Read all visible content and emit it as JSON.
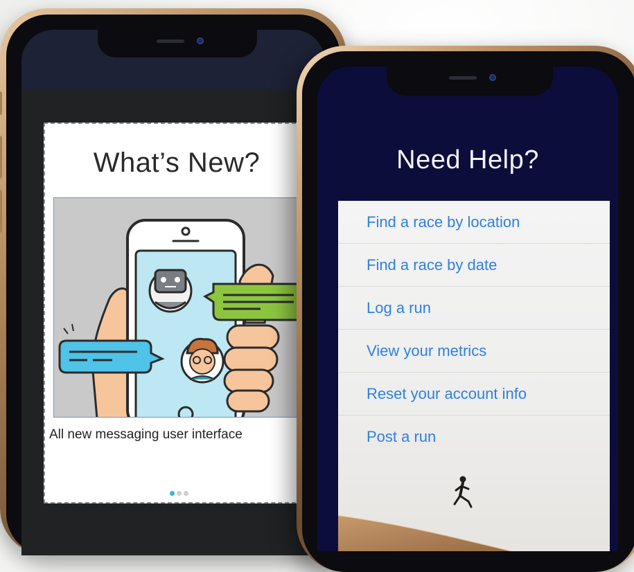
{
  "whats_new": {
    "title": "What’s New?",
    "caption": "All new messaging user interface",
    "pager": {
      "count": 3,
      "active_index": 0
    }
  },
  "need_help": {
    "title": "Need Help?",
    "items": [
      {
        "label": "Find a race by location"
      },
      {
        "label": "Find a race by date"
      },
      {
        "label": "Log a run"
      },
      {
        "label": "View your metrics"
      },
      {
        "label": "Reset your account info"
      },
      {
        "label": "Post a run"
      }
    ]
  },
  "colors": {
    "link_blue": "#2f7fe0",
    "help_background": "#0c0d3a",
    "pager_active": "#38b7d8",
    "bubble_green": "#8cc63f",
    "bubble_blue": "#4fc3e8"
  },
  "icons": {
    "illustration": "phone-chat-illustration",
    "bot_avatar": "robot-avatar-icon",
    "user_avatar": "man-avatar-icon",
    "runner": "runner-silhouette-icon"
  }
}
